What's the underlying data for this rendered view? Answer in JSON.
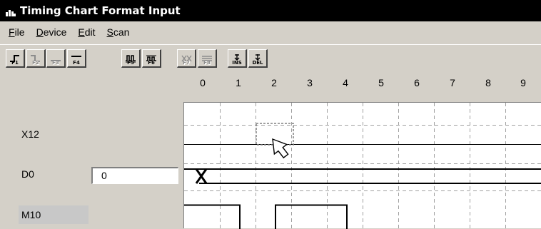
{
  "window": {
    "title": "Timing Chart Format Input"
  },
  "menu": [
    {
      "label": "File",
      "accel": "F",
      "rest": "ile"
    },
    {
      "label": "Device",
      "accel": "D",
      "rest": "evice"
    },
    {
      "label": "Edit",
      "accel": "E",
      "rest": "dit"
    },
    {
      "label": "Scan",
      "accel": "S",
      "rest": "can"
    }
  ],
  "toolbar": [
    {
      "caption": "F1",
      "enabled": true,
      "icon": "rising-edge-icon"
    },
    {
      "caption": "F2",
      "enabled": false,
      "icon": "falling-edge-icon"
    },
    {
      "caption": "F3",
      "enabled": false,
      "icon": "low-level-icon"
    },
    {
      "caption": "F4",
      "enabled": true,
      "icon": "high-level-icon"
    },
    {
      "caption": "F5",
      "enabled": true,
      "icon": "pulse-pattern-icon"
    },
    {
      "caption": "F6",
      "enabled": true,
      "icon": "clock-pattern-icon"
    },
    {
      "caption": "F7",
      "enabled": false,
      "icon": "invert-pattern-icon"
    },
    {
      "caption": "F8",
      "enabled": false,
      "icon": "reset-level-icon"
    },
    {
      "caption": "INS",
      "enabled": true,
      "icon": "insert-icon"
    },
    {
      "caption": "DEL",
      "enabled": true,
      "icon": "delete-icon"
    }
  ],
  "time_axis": [
    "0",
    "1",
    "2",
    "3",
    "4",
    "5",
    "6",
    "7",
    "8",
    "9"
  ],
  "signals": {
    "x12": {
      "label": "X12"
    },
    "d0": {
      "label": "D0",
      "value": "0"
    },
    "m10": {
      "label": "M10",
      "states": [
        1,
        0,
        1,
        1,
        0
      ]
    }
  },
  "selection": {
    "signal": "X12",
    "time_slot": 2
  },
  "colors": {
    "titlebar": "#000000",
    "face": "#d4d0c8",
    "grid": "#a0a0a0",
    "wave": "#000000"
  }
}
